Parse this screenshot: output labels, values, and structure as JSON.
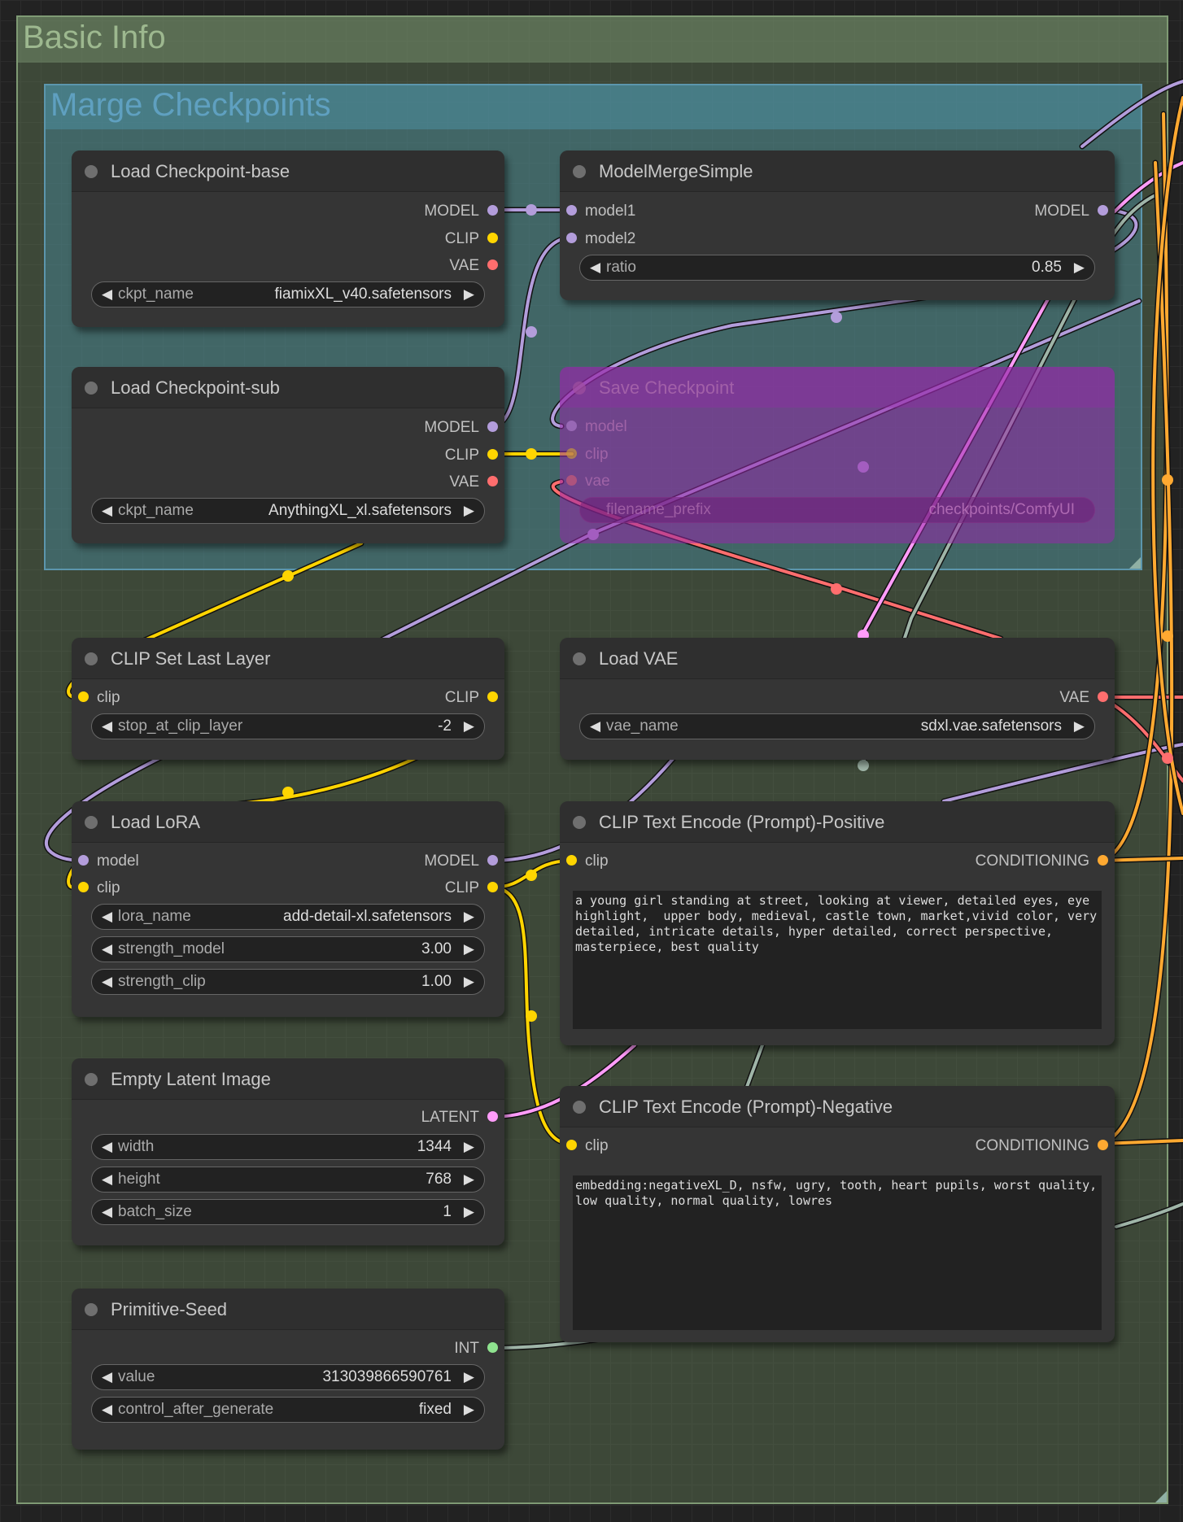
{
  "groups": {
    "basic_info": "Basic Info",
    "merge_checkpoints": "Marge Checkpoints"
  },
  "colors": {
    "model": "#b39ddb",
    "clip": "#ffd500",
    "vae": "#ff6e6e",
    "latent": "#ff9cf9",
    "conditioning": "#ffa931",
    "int": "#8fe38f",
    "link_gray": "#9fb5a8"
  },
  "nodes": {
    "load_ckpt_base": {
      "title": "Load Checkpoint-base",
      "outputs": [
        "MODEL",
        "CLIP",
        "VAE"
      ],
      "ckpt_label": "ckpt_name",
      "ckpt_value": "fiamixXL_v40.safetensors"
    },
    "load_ckpt_sub": {
      "title": "Load Checkpoint-sub",
      "outputs": [
        "MODEL",
        "CLIP",
        "VAE"
      ],
      "ckpt_label": "ckpt_name",
      "ckpt_value": "AnythingXL_xl.safetensors"
    },
    "model_merge": {
      "title": "ModelMergeSimple",
      "inputs": [
        "model1",
        "model2"
      ],
      "output": "MODEL",
      "ratio_label": "ratio",
      "ratio_value": "0.85"
    },
    "save_checkpoint": {
      "title": "Save Checkpoint",
      "inputs": [
        "model",
        "clip",
        "vae"
      ],
      "prefix_label": "filename_prefix",
      "prefix_value": "checkpoints/ComfyUI"
    },
    "clip_set_last_layer": {
      "title": "CLIP Set Last Layer",
      "input": "clip",
      "output": "CLIP",
      "layer_label": "stop_at_clip_layer",
      "layer_value": "-2"
    },
    "load_vae": {
      "title": "Load VAE",
      "output": "VAE",
      "vae_label": "vae_name",
      "vae_value": "sdxl.vae.safetensors"
    },
    "load_lora": {
      "title": "Load LoRA",
      "inputs": [
        "model",
        "clip"
      ],
      "outputs": [
        "MODEL",
        "CLIP"
      ],
      "lora_label": "lora_name",
      "lora_value": "add-detail-xl.safetensors",
      "sm_label": "strength_model",
      "sm_value": "3.00",
      "sc_label": "strength_clip",
      "sc_value": "1.00"
    },
    "clip_positive": {
      "title": "CLIP Text Encode (Prompt)-Positive",
      "input": "clip",
      "output": "CONDITIONING",
      "text": "a young girl standing at street, looking at viewer, detailed eyes, eye highlight,  upper body, medieval, castle town, market,vivid color, very detailed, intricate details, hyper detailed, correct perspective, masterpiece, best quality"
    },
    "clip_negative": {
      "title": "CLIP Text Encode (Prompt)-Negative",
      "input": "clip",
      "output": "CONDITIONING",
      "text": "embedding:negativeXL_D, nsfw, ugry, tooth, heart pupils, worst quality, low quality, normal quality, lowres"
    },
    "empty_latent": {
      "title": "Empty Latent Image",
      "output": "LATENT",
      "width_label": "width",
      "width_value": "1344",
      "height_label": "height",
      "height_value": "768",
      "batch_label": "batch_size",
      "batch_value": "1"
    },
    "primitive_seed": {
      "title": "Primitive-Seed",
      "output": "INT",
      "value_label": "value",
      "value_value": "313039866590761",
      "control_label": "control_after_generate",
      "control_value": "fixed"
    }
  }
}
